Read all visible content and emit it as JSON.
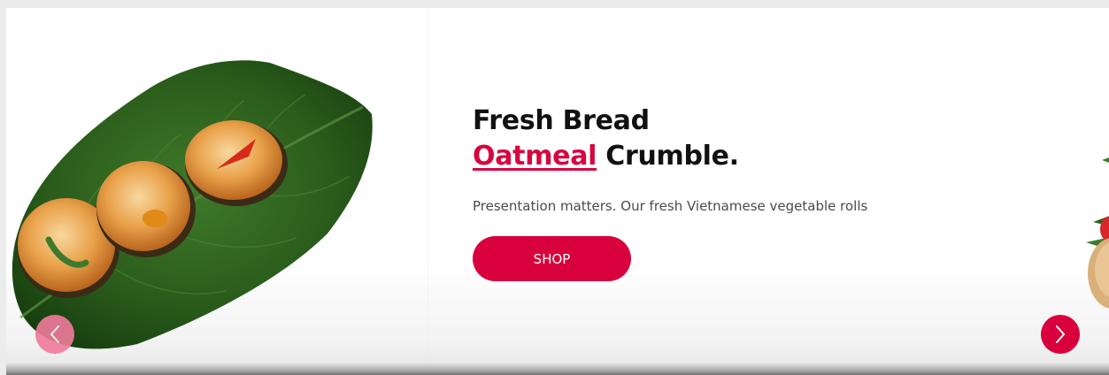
{
  "hero": {
    "headline_line1": "Fresh Bread",
    "headline_accent": "Oatmeal",
    "headline_rest": " Crumble.",
    "subtitle": "Presentation matters. Our fresh Vietnamese vegetable rolls",
    "cta_label": "SHOP"
  },
  "slider_nav": {
    "prev_icon": "chevron-left-icon",
    "next_icon": "chevron-right-icon"
  },
  "colors": {
    "accent": "#d8003d",
    "prev_button": "#f07b9b",
    "heading": "#111111",
    "body_text": "#4a4a4a"
  }
}
